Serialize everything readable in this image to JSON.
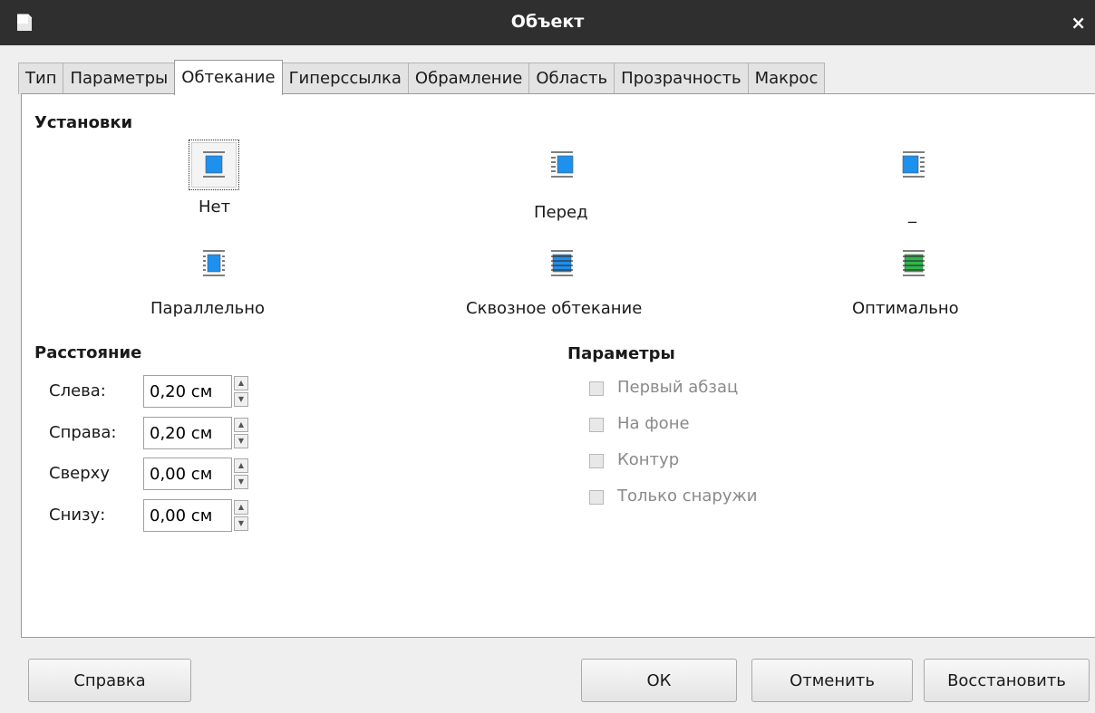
{
  "window": {
    "title": "Объект",
    "close_glyph": "×"
  },
  "tabs": [
    {
      "label": "Тип"
    },
    {
      "label": "Параметры"
    },
    {
      "label": "Обтекание",
      "active": true
    },
    {
      "label": "Гиперссылка"
    },
    {
      "label": "Обрамление"
    },
    {
      "label": "Область"
    },
    {
      "label": "Прозрачность"
    },
    {
      "label": "Макрос"
    }
  ],
  "settings": {
    "heading": "Установки",
    "options": [
      {
        "label": "Нет",
        "icon": "wrap-none-icon",
        "focused": true
      },
      {
        "label": "Перед",
        "icon": "wrap-before-icon"
      },
      {
        "label": "_",
        "icon": "wrap-after-icon"
      },
      {
        "label": "Параллельно",
        "icon": "wrap-parallel-icon"
      },
      {
        "label": "Сквозное обтекание",
        "icon": "wrap-through-icon"
      },
      {
        "label": "Оптимально",
        "icon": "wrap-optimal-icon"
      }
    ]
  },
  "spacing": {
    "heading": "Расстояние",
    "fields": [
      {
        "label": "Слева:",
        "value": "0,20 см"
      },
      {
        "label": "Справа:",
        "value": "0,20 см"
      },
      {
        "label": "Сверху",
        "value": "0,00 см"
      },
      {
        "label": "Снизу:",
        "value": "0,00 см"
      }
    ]
  },
  "options": {
    "heading": "Параметры",
    "checkboxes": [
      {
        "label": "Первый абзац",
        "checked": false,
        "enabled": false
      },
      {
        "label": "На фоне",
        "checked": false,
        "enabled": false
      },
      {
        "label": "Контур",
        "checked": false,
        "enabled": false
      },
      {
        "label": "Только снаружи",
        "checked": false,
        "enabled": false
      }
    ]
  },
  "buttons": {
    "help": "Справка",
    "ok": "ОК",
    "cancel": "Отменить",
    "reset": "Восстановить"
  },
  "colors": {
    "accent_blue": "#1e90ee",
    "accent_green": "#2db84a",
    "titlebar": "#2f2f2f"
  }
}
